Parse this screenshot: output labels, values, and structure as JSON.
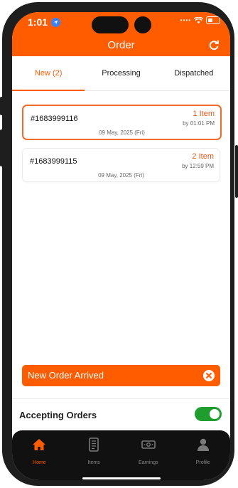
{
  "status_bar": {
    "time": "1:01"
  },
  "header": {
    "title": "Order"
  },
  "tabs": [
    {
      "label": "New (2)",
      "active": true
    },
    {
      "label": "Processing",
      "active": false
    },
    {
      "label": "Dispatched",
      "active": false
    }
  ],
  "orders": [
    {
      "id": "#1683999116",
      "items": "1 Item",
      "by": "by 01:01 PM",
      "date": "09 May, 2025 (Fri)",
      "selected": true
    },
    {
      "id": "#1683999115",
      "items": "2 Item",
      "by": "by 12:59 PM",
      "date": "09 May, 2025 (Fri)",
      "selected": false
    }
  ],
  "toast": {
    "text": "New Order Arrived"
  },
  "accepting": {
    "label": "Accepting Orders",
    "enabled": true
  },
  "nav": [
    {
      "label": "Home",
      "icon": "home-icon",
      "active": true
    },
    {
      "label": "Items",
      "icon": "items-icon",
      "active": false
    },
    {
      "label": "Earnings",
      "icon": "earnings-icon",
      "active": false
    },
    {
      "label": "Profile",
      "icon": "profile-icon",
      "active": false
    }
  ],
  "colors": {
    "accent": "#ff5c00",
    "toggle_on": "#1f9d2f",
    "nav_bg": "#111111"
  }
}
